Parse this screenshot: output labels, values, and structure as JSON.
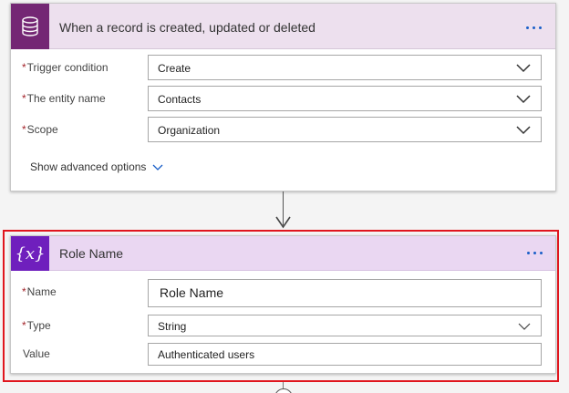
{
  "trigger_card": {
    "title": "When a record is created, updated or deleted",
    "icon": "database-icon",
    "fields": [
      {
        "label": "Trigger condition",
        "required": "*",
        "value": "Create"
      },
      {
        "label": "The entity name",
        "required": "*",
        "value": "Contacts"
      },
      {
        "label": "Scope",
        "required": "*",
        "value": "Organization"
      }
    ],
    "advanced_label": "Show advanced options"
  },
  "variable_card": {
    "title": "Role Name",
    "icon_text": "{x}",
    "fields": [
      {
        "label": "Name",
        "required": "*",
        "value": "Role Name"
      },
      {
        "label": "Type",
        "required": "*",
        "value": "String"
      },
      {
        "label": "Value",
        "required": "",
        "value": "Authenticated users"
      }
    ]
  },
  "colors": {
    "trigger_accent": "#742774",
    "variable_accent": "#6f1fbd",
    "highlight_border": "#e0161e",
    "link_blue": "#1a5fc8"
  }
}
